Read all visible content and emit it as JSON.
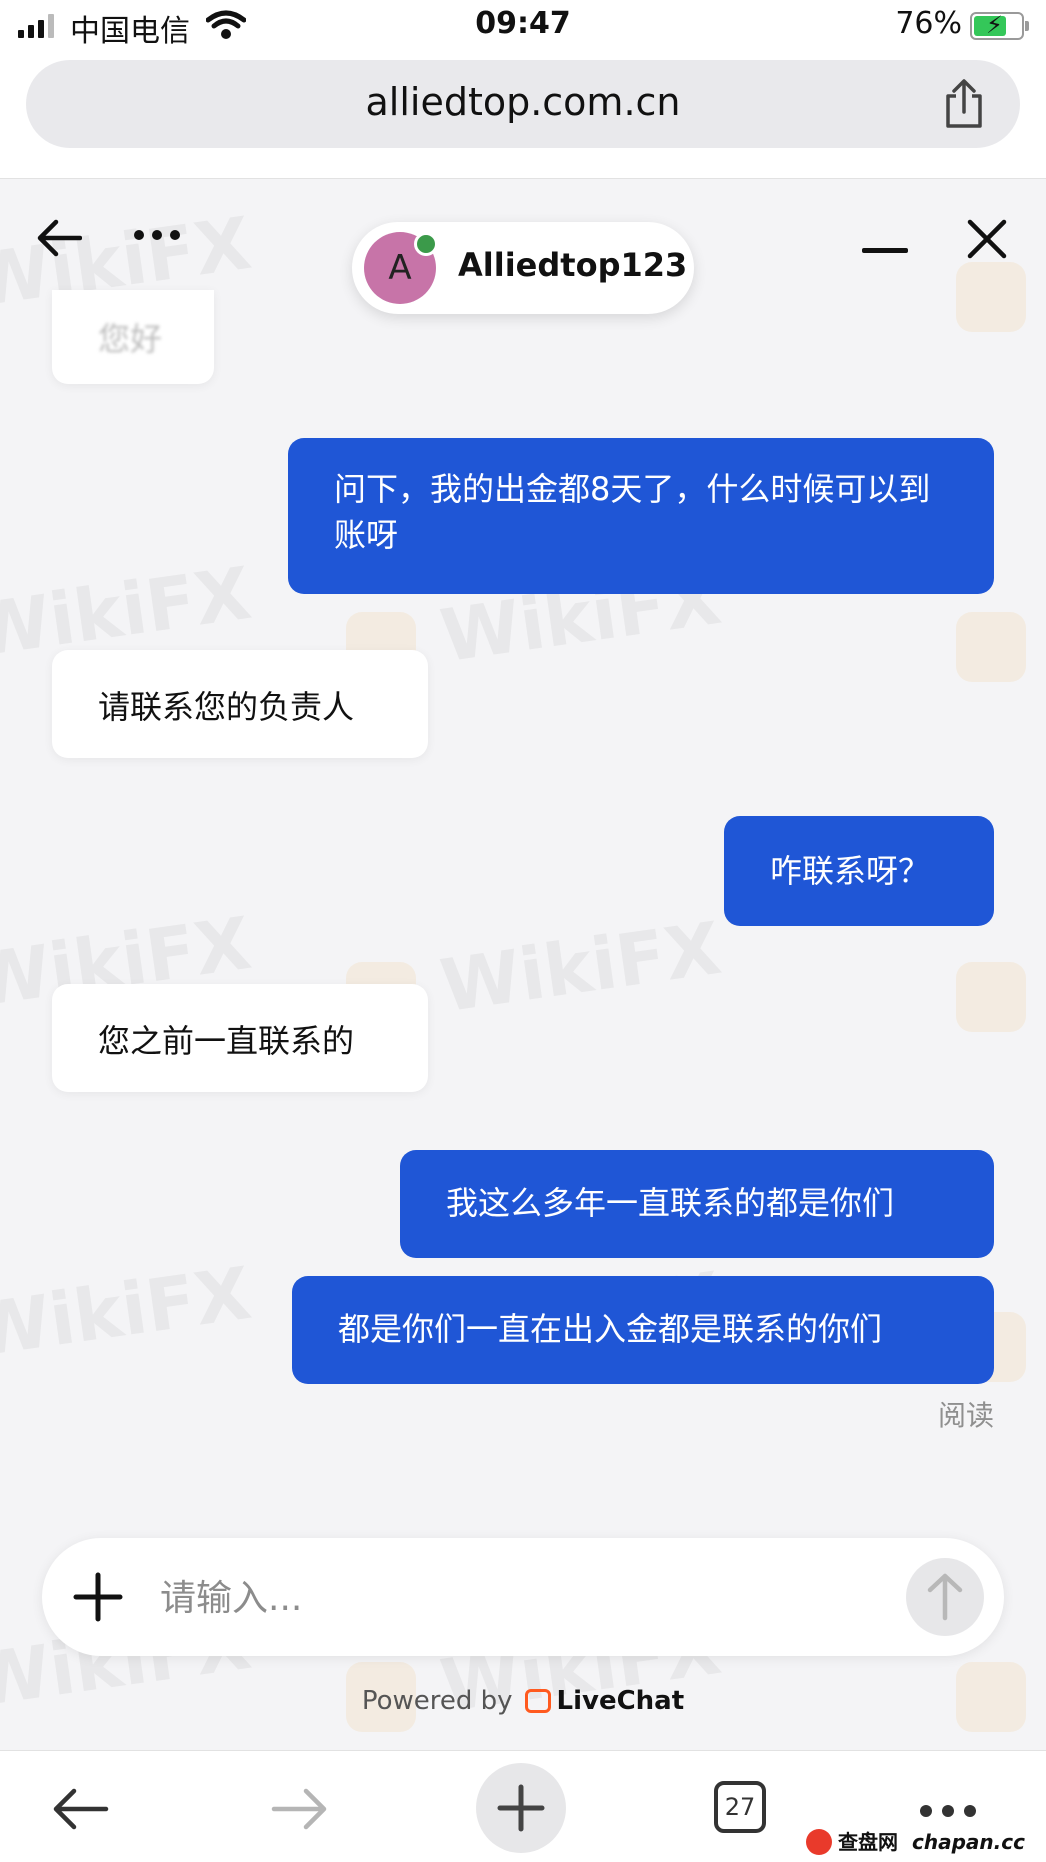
{
  "status_bar": {
    "carrier": "中国电信",
    "time": "09:47",
    "battery_percent": "76%",
    "battery_level": 0.76,
    "icons": [
      "signal-icon",
      "wifi-icon",
      "battery-charging-icon"
    ]
  },
  "browser": {
    "url": "alliedtop.com.cn",
    "share_icon": "share-icon"
  },
  "chat_header": {
    "agent_initial": "A",
    "agent_name": "Alliedtop123",
    "agent_online": true,
    "icons": [
      "back-arrow-icon",
      "more-dots-icon",
      "minimize-icon",
      "close-icon"
    ]
  },
  "messages": [
    {
      "side": "in",
      "text": "您好",
      "faded": true
    },
    {
      "side": "out",
      "text": "问下，我的出金都8天了，什么时候可以到账呀"
    },
    {
      "side": "in",
      "text": "请联系您的负责人"
    },
    {
      "side": "out",
      "text": "咋联系呀？"
    },
    {
      "side": "in",
      "text": "您之前一直联系的"
    },
    {
      "side": "out",
      "text": "我这么多年一直联系的都是你们"
    },
    {
      "side": "out",
      "text": "都是你们一直在出入金都是联系的你们"
    }
  ],
  "read_receipt": "阅读",
  "composer": {
    "placeholder": "请输入...",
    "icons": [
      "plus-icon",
      "send-arrow-icon"
    ]
  },
  "powered_by": {
    "prefix": "Powered by",
    "brand": "LiveChat"
  },
  "watermark": {
    "text": "WikiFX"
  },
  "bottom_nav": {
    "tab_count": "27",
    "icons": [
      "nav-back-icon",
      "nav-forward-icon",
      "new-tab-icon",
      "tabs-icon",
      "more-icon"
    ]
  },
  "source_mark": {
    "label": "查盘网",
    "site": "chapan.cc"
  },
  "colors": {
    "outgoing_bubble": "#1f56d6",
    "incoming_bubble": "#ffffff",
    "background": "#f4f4f6",
    "avatar": "#c774a8",
    "online_dot": "#3b9a4a",
    "livechat_orange": "#ff5a1f"
  }
}
